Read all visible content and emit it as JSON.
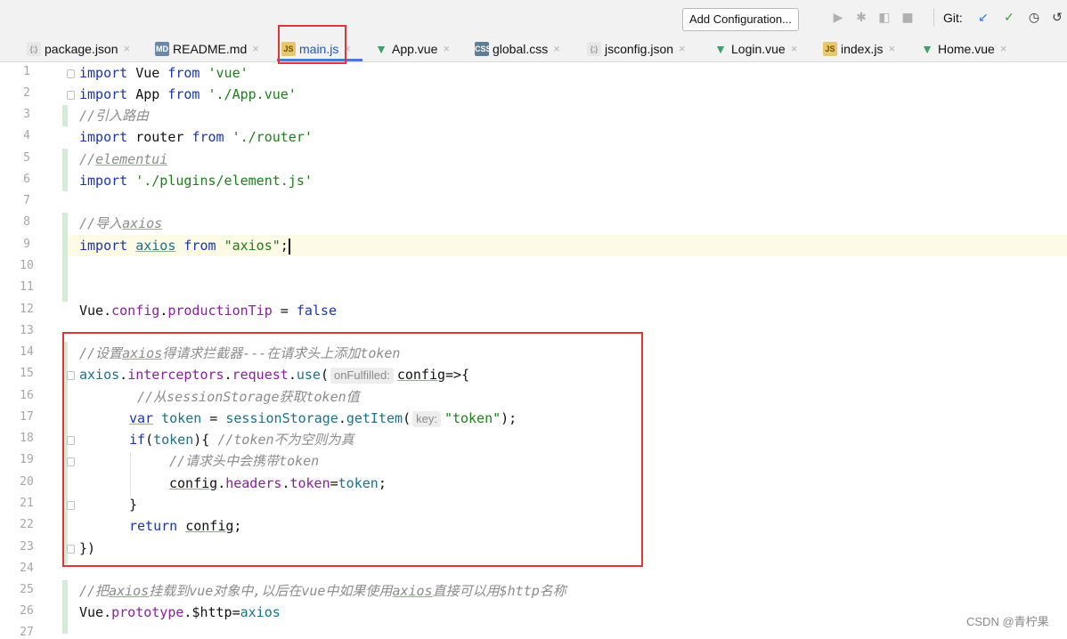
{
  "toolbar": {
    "add_configuration": "Add Configuration...",
    "git_label": "Git:",
    "icons": [
      "run-icon",
      "debug-icon",
      "coverage-icon",
      "stop-icon",
      "git-update-icon",
      "git-commit-icon",
      "git-history-icon",
      "git-rollback-icon"
    ]
  },
  "tabs": [
    {
      "label": "package.json",
      "icon": "json-file-icon",
      "close": "×"
    },
    {
      "label": "README.md",
      "icon": "markdown-file-icon",
      "close": "×"
    },
    {
      "label": "main.js",
      "icon": "js-file-icon",
      "close": "×",
      "active": true
    },
    {
      "label": "App.vue",
      "icon": "vue-file-icon",
      "close": "×"
    },
    {
      "label": "global.css",
      "icon": "css-file-icon",
      "close": "×"
    },
    {
      "label": "jsconfig.json",
      "icon": "json-file-icon",
      "close": "×"
    },
    {
      "label": "Login.vue",
      "icon": "vue-file-icon",
      "close": "×"
    },
    {
      "label": "index.js",
      "icon": "js-file-icon",
      "close": "×"
    },
    {
      "label": "Home.vue",
      "icon": "vue-file-icon",
      "close": "×"
    }
  ],
  "file_icon_glyphs": {
    "json": "{;}",
    "md": "MD",
    "js": "JS",
    "css": "CSS",
    "vue": "▼"
  },
  "line_numbers": [
    "1",
    "2",
    "3",
    "4",
    "5",
    "6",
    "7",
    "8",
    "9",
    "10",
    "11",
    "12",
    "13",
    "14",
    "15",
    "16",
    "17",
    "18",
    "19",
    "20",
    "21",
    "22",
    "23",
    "24",
    "25",
    "26",
    "27"
  ],
  "code": {
    "l1": {
      "a": "import",
      "b": " Vue ",
      "c": "from",
      "d": " ",
      "e": "'vue'"
    },
    "l2": {
      "a": "import",
      "b": " App ",
      "c": "from",
      "d": " ",
      "e": "'./App.vue'"
    },
    "l3": {
      "comment": "//引入路由"
    },
    "l4": {
      "a": "import",
      "b": " router ",
      "c": "from",
      "d": " ",
      "e": "'./router'"
    },
    "l5": {
      "comment_prefix": "//",
      "comment_word": "elementui"
    },
    "l6": {
      "a": "import",
      "b": " ",
      "e": "'./plugins/element.js'"
    },
    "l8": {
      "comment_prefix": "//导入",
      "comment_word": "axios"
    },
    "l9": {
      "a": "import",
      "b": " ",
      "v": "axios",
      "c": " from ",
      "e": "\"axios\"",
      "f": ";"
    },
    "l12": {
      "a": "Vue",
      "b": ".",
      "p1": "config",
      "c": ".",
      "p2": "productionTip",
      "d": " = ",
      "k": "false"
    },
    "l14": {
      "c1": "//设置",
      "w": "axios",
      "c2": "得请求拦截器---在请求头上添加token"
    },
    "l15": {
      "a": "axios",
      "b": ".",
      "p1": "interceptors",
      "c": ".",
      "p2": "request",
      "d": ".",
      "fn": "use",
      "e": "(",
      "hint": "onFulfilled:",
      "param": "config",
      "f": "=>{"
    },
    "l16": {
      "comment": "//从sessionStorage获取token值"
    },
    "l17": {
      "k": "var",
      "v": " token",
      "b": " = ",
      "o": "sessionStorage",
      "c": ".",
      "fn": "getItem",
      "d": "(",
      "hint": "key:",
      "s": "\"token\"",
      "e": ");"
    },
    "l18": {
      "k": "if",
      "a": "(",
      "v": "token",
      "b": "){ ",
      "comment": "//token不为空则为真"
    },
    "l19": {
      "comment": "//请求头中会携带token"
    },
    "l20": {
      "u": "config",
      "a": ".",
      "p1": "headers",
      "b": ".",
      "p2": "token",
      "c": "=",
      "v": "token",
      "d": ";"
    },
    "l21": {
      "a": "}"
    },
    "l22": {
      "k": "return",
      "b": " ",
      "u": "config",
      "c": ";"
    },
    "l23": {
      "a": "})"
    },
    "l25": {
      "c1": "//把",
      "w1": "axios",
      "c2": "挂载到vue对象中,以后在vue中如果使用",
      "w2": "axios",
      "c3": "直接可以用$http名称"
    },
    "l26": {
      "a": "Vue",
      "b": ".",
      "p1": "prototype",
      "c": ".$http=",
      "v": "axios"
    }
  },
  "watermark": "CSDN @青柠果"
}
